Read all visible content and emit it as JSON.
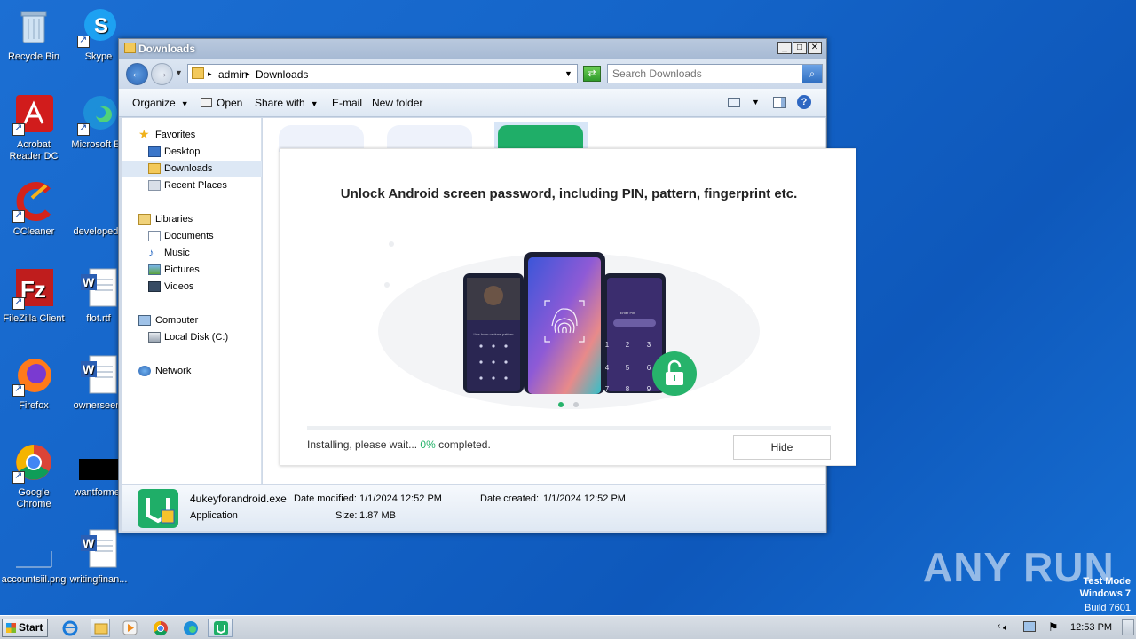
{
  "desktop": {
    "icons": [
      {
        "label": "Recycle Bin"
      },
      {
        "label": "Skype"
      },
      {
        "label": "Acrobat Reader DC"
      },
      {
        "label": "Microsoft Ed"
      },
      {
        "label": "CCleaner"
      },
      {
        "label": "developedb"
      },
      {
        "label": "FileZilla Client"
      },
      {
        "label": "flot.rtf"
      },
      {
        "label": "Firefox"
      },
      {
        "label": "ownerseen."
      },
      {
        "label": "Google Chrome"
      },
      {
        "label": "wantformer"
      },
      {
        "label": "accountsiil.png"
      },
      {
        "label": "writingfinan..."
      }
    ]
  },
  "explorer": {
    "title": "Downloads",
    "breadcrumb": [
      "admin",
      "Downloads"
    ],
    "search_placeholder": "Search Downloads",
    "toolbar": {
      "organize": "Organize",
      "open": "Open",
      "share_with": "Share with",
      "email": "E-mail",
      "new_folder": "New folder"
    },
    "nav": {
      "favorites": "Favorites",
      "desktop": "Desktop",
      "downloads": "Downloads",
      "recent_places": "Recent Places",
      "libraries": "Libraries",
      "documents": "Documents",
      "music": "Music",
      "pictures": "Pictures",
      "videos": "Videos",
      "computer": "Computer",
      "local_disk": "Local Disk (C:)",
      "network": "Network"
    },
    "details": {
      "filename": "4ukeyforandroid.exe",
      "type": "Application",
      "date_modified_label": "Date modified:",
      "date_modified": "1/1/2024 12:52 PM",
      "date_created_label": "Date created:",
      "date_created": "1/1/2024 12:52 PM",
      "size_label": "Size:",
      "size": "1.87 MB"
    }
  },
  "installer": {
    "headline": "Unlock Android screen password, including PIN, pattern, fingerprint etc.",
    "status_prefix": "Installing, please wait...",
    "progress_pct": "0%",
    "status_suffix": "completed.",
    "progress": 0,
    "hide_label": "Hide",
    "phone_left_caption": "Use lnum or draw pattern",
    "phone_right_caption": "Enter Pin",
    "keypad": [
      "1",
      "2",
      "3",
      "4",
      "5",
      "6",
      "7",
      "8",
      "9"
    ],
    "accent": "#27b36b"
  },
  "taskbar": {
    "start": "Start",
    "clock": "12:53 PM"
  },
  "watermark": "ANY RUN",
  "testmode": [
    "Test Mode",
    "Windows 7",
    "Build 7601"
  ]
}
